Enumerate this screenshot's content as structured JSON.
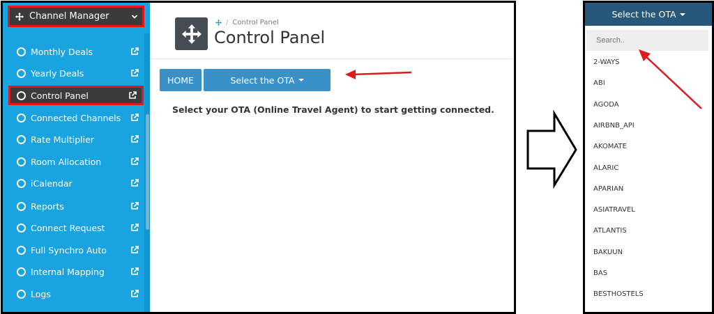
{
  "sidebar": {
    "header": "Channel Manager",
    "items": [
      {
        "label": "Monthly Deals"
      },
      {
        "label": "Yearly Deals"
      },
      {
        "label": "Control Panel"
      },
      {
        "label": "Connected Channels"
      },
      {
        "label": "Rate Multiplier"
      },
      {
        "label": "Room Allocation"
      },
      {
        "label": "iCalendar"
      },
      {
        "label": "Reports"
      },
      {
        "label": "Connect Request"
      },
      {
        "label": "Full Synchro Auto"
      },
      {
        "label": "Internal Mapping"
      },
      {
        "label": "Logs"
      }
    ]
  },
  "main": {
    "breadcrumb": "Control Panel",
    "title": "Control Panel",
    "home_button": "HOME",
    "ota_button": "Select the OTA",
    "instruction": "Select your OTA (Online Travel Agent) to start getting connected."
  },
  "dropdown": {
    "header": "Select the OTA",
    "search_placeholder": "Search..",
    "options": [
      "2-WAYS",
      "ABI",
      "AGODA",
      "AIRBNB_API",
      "AKOMATE",
      "ALARIC",
      "APARIAN",
      "ASIATRAVEL",
      "ATLANTIS",
      "BAKUUN",
      "BAS",
      "BESTHOSTELS"
    ]
  },
  "colors": {
    "sidebar_bg": "#19a3e0",
    "active_bg": "#3b3b3b",
    "highlight_border": "#e0191c",
    "button_bg": "#3a91c8",
    "dropdown_header_bg": "#27577a"
  }
}
